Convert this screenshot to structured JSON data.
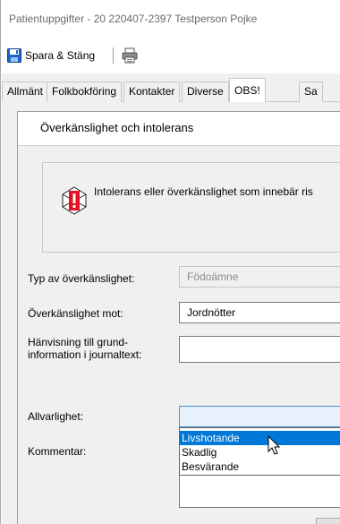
{
  "window": {
    "title": "Patientuppgifter - 20  220407-2397 Testperson Pojke"
  },
  "toolbar": {
    "save_close_label": "Spara & Stäng",
    "save_icon": "floppy-disk-icon",
    "print_icon": "printer-icon"
  },
  "tabs": [
    {
      "label": "Allmänt"
    },
    {
      "label": "Folkbokföring"
    },
    {
      "label": "Kontakter"
    },
    {
      "label": "Diverse"
    },
    {
      "label": "OBS!"
    },
    {
      "label": "Sa"
    }
  ],
  "dialog": {
    "title": "Överkänslighet och intolerans",
    "warning": {
      "icon": "medical-alert-icon",
      "text": "Intolerans eller överkänslighet som innebär ris"
    },
    "fields": {
      "type_label": "Typ av överkänslighet:",
      "type_value": "Födoämne",
      "against_label": "Överkänslighet mot:",
      "against_value": "Jordnötter",
      "reference_label_line1": "Hänvisning till grund-",
      "reference_label_line2": "information i journaltext:",
      "reference_value": "",
      "severity_label": "Allvarlighet:",
      "severity_value": "",
      "comment_label": "Kommentar:"
    },
    "severity_options": [
      {
        "label": "Livshotande",
        "selected": true
      },
      {
        "label": "Skadlig",
        "selected": false
      },
      {
        "label": "Besvärande",
        "selected": false
      }
    ]
  },
  "colors": {
    "selection": "#0078d7",
    "alert_red": "#e81123",
    "panel_bg": "#f0f0f0"
  }
}
